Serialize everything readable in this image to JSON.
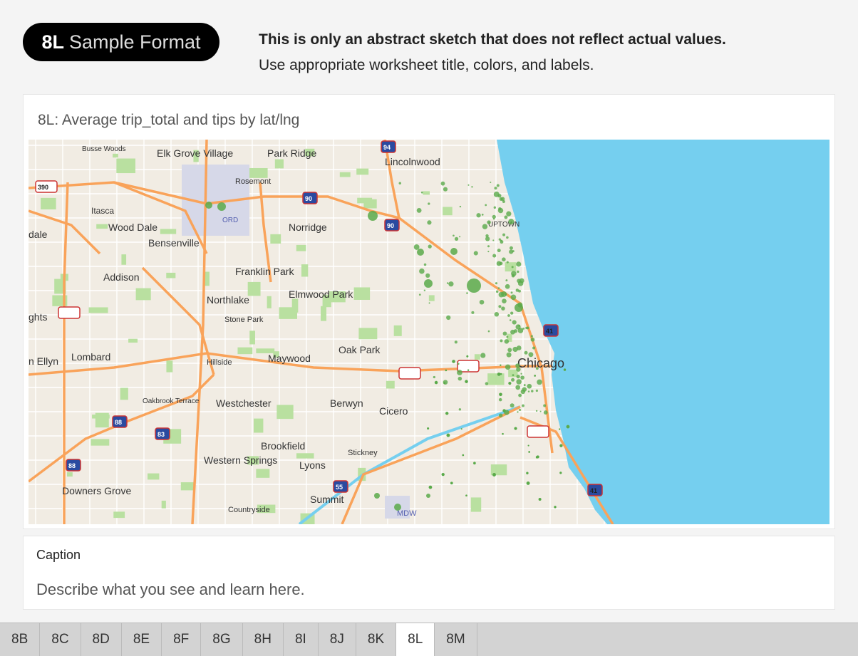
{
  "header": {
    "badge_code": "8L",
    "badge_label": "Sample Format",
    "note_line1": "This is only an abstract sketch that does not reflect actual values.",
    "note_line2": "Use appropriate worksheet title, colors, and labels."
  },
  "worksheet": {
    "title": "8L: Average trip_total and tips by lat/lng"
  },
  "map": {
    "colors": {
      "land": "#f1ece3",
      "water": "#75cfef",
      "highway": "#f9a35a",
      "park": "#b9e0a0",
      "marks": "#5aaa4a"
    },
    "places": [
      "Busse Woods",
      "Elk Grove Village",
      "Park Ridge",
      "Lincolnwood",
      "Rosemont",
      "Itasca",
      "Wood Dale",
      "Bensenville",
      "ORD",
      "Norridge",
      "UPTOWN",
      "Addison",
      "Franklin Park",
      "Elmwood Park",
      "Northlake",
      "Stone Park",
      "Oak Park",
      "Lombard",
      "Hillside",
      "Maywood",
      "Chicago",
      "Oakbrook Terrace",
      "Westchester",
      "Berwyn",
      "Cicero",
      "Brookfield",
      "Stickney",
      "Western Springs",
      "Lyons",
      "Downers Grove",
      "Summit",
      "Countryside",
      "MDW",
      "dale",
      "ghts",
      "n Ellyn"
    ],
    "shields": [
      "94",
      "390",
      "90",
      "90",
      "355",
      "290",
      "290",
      "88",
      "83",
      "88",
      "55",
      "90-94",
      "41",
      "41"
    ]
  },
  "caption": {
    "heading": "Caption",
    "placeholder": "Describe what you see and learn here."
  },
  "tabs": [
    "8B",
    "8C",
    "8D",
    "8E",
    "8F",
    "8G",
    "8H",
    "8I",
    "8J",
    "8K",
    "8L",
    "8M"
  ],
  "active_tab": "8L"
}
